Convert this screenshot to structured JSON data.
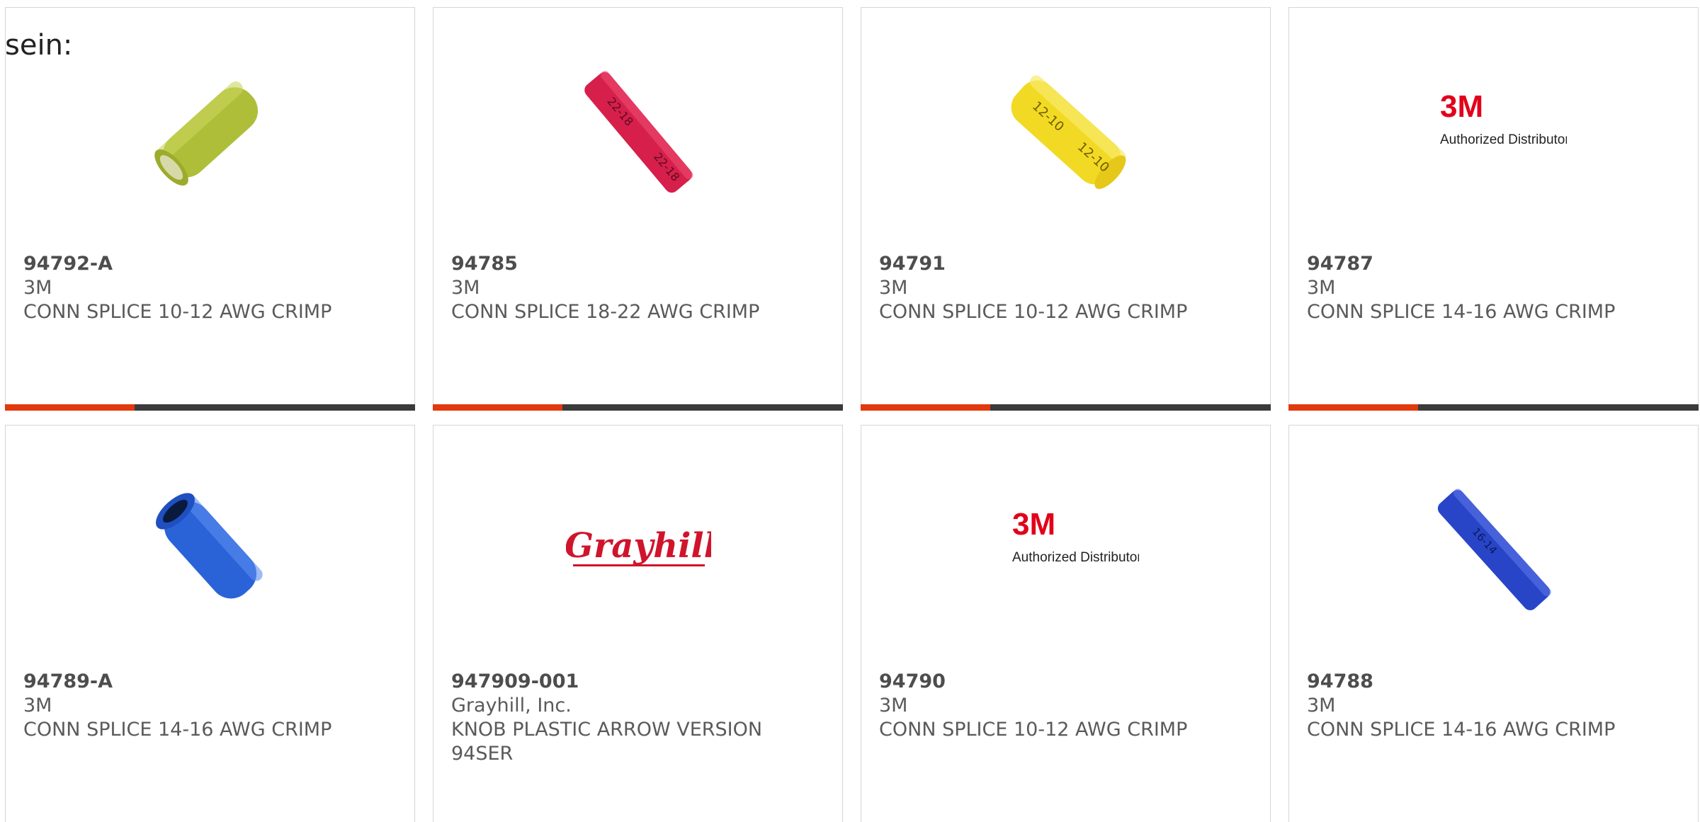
{
  "page": {
    "prefix_text": "sein:"
  },
  "products": [
    {
      "part_number": "94792-A",
      "manufacturer": "3M",
      "description": "CONN SPLICE 10-12 AWG CRIMP",
      "image": "yellow-green-butt-splice",
      "image_color": "#b3c23a"
    },
    {
      "part_number": "94785",
      "manufacturer": "3M",
      "description": "CONN SPLICE 18-22 AWG CRIMP",
      "image": "red-butt-splice",
      "image_color": "#d9224d",
      "image_print": "22-18"
    },
    {
      "part_number": "94791",
      "manufacturer": "3M",
      "description": "CONN SPLICE 10-12 AWG CRIMP",
      "image": "yellow-butt-splice",
      "image_color": "#f2dc2a",
      "image_print": "12-10"
    },
    {
      "part_number": "94787",
      "manufacturer": "3M",
      "description": "CONN SPLICE 14-16 AWG CRIMP",
      "image": "3m-authorized-distributor-logo",
      "logo_mark": "3M",
      "logo_caption": "Authorized Distributor"
    },
    {
      "part_number": "94789-A",
      "manufacturer": "3M",
      "description": "CONN SPLICE 14-16 AWG CRIMP",
      "image": "blue-butt-splice",
      "image_color": "#1f5ad6"
    },
    {
      "part_number": "947909-001",
      "manufacturer": "Grayhill, Inc.",
      "description": "KNOB PLASTIC ARROW VERSION 94SER",
      "image": "grayhill-logo",
      "logo_mark": "Grayhill"
    },
    {
      "part_number": "94790",
      "manufacturer": "3M",
      "description": "CONN SPLICE 10-12 AWG CRIMP",
      "image": "3m-authorized-distributor-logo",
      "logo_mark": "3M",
      "logo_caption": "Authorized Distributor"
    },
    {
      "part_number": "94788",
      "manufacturer": "3M",
      "description": "CONN SPLICE 14-16 AWG CRIMP",
      "image": "blue-butt-splice",
      "image_color": "#2845c8",
      "image_print": "16-14"
    }
  ],
  "colors": {
    "accent": "#e2390f",
    "bar": "#3b3b3b",
    "border": "#d6d6d6",
    "brand_3m": "#e2001a",
    "brand_grayhill": "#d0142c"
  }
}
